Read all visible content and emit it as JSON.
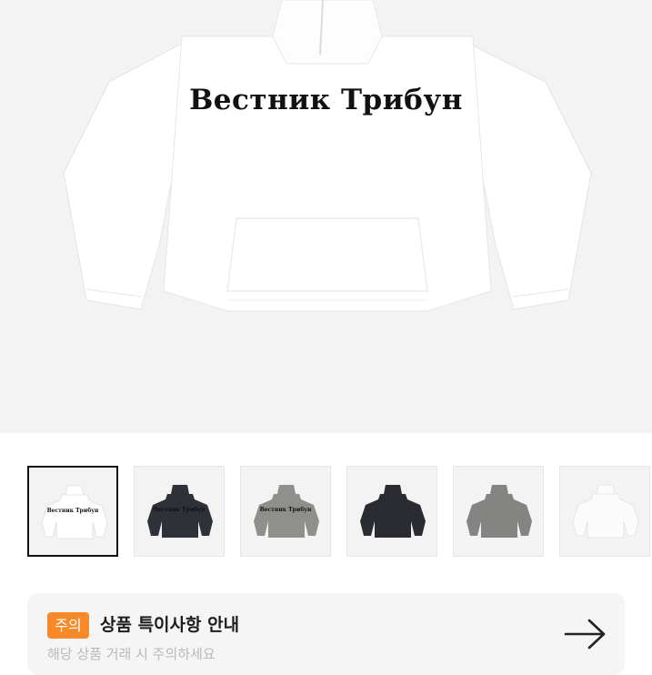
{
  "product": {
    "print_text": "Вестник Трибун"
  },
  "gallery": {
    "thumbnails": [
      {
        "color": "#ffffff",
        "print": "Вестник Трибун",
        "selected": true
      },
      {
        "color": "#2e3137",
        "print": "Вестник Трибун",
        "selected": false
      },
      {
        "color": "#8f8f8c",
        "print": "Вестник Трибун",
        "selected": false
      },
      {
        "color": "#2a2c31",
        "print": "",
        "selected": false
      },
      {
        "color": "#848482",
        "print": "",
        "selected": false
      },
      {
        "color": "#fbfbfb",
        "print": "",
        "selected": false
      }
    ]
  },
  "notice": {
    "badge": "주의",
    "title": "상품 특이사항 안내",
    "subtitle": "해당 상품 거래 시 주의하세요",
    "arrow_icon": "arrow-right-icon"
  },
  "colors": {
    "accent": "#f7892b",
    "hero_bg": "#f3f3f3"
  }
}
